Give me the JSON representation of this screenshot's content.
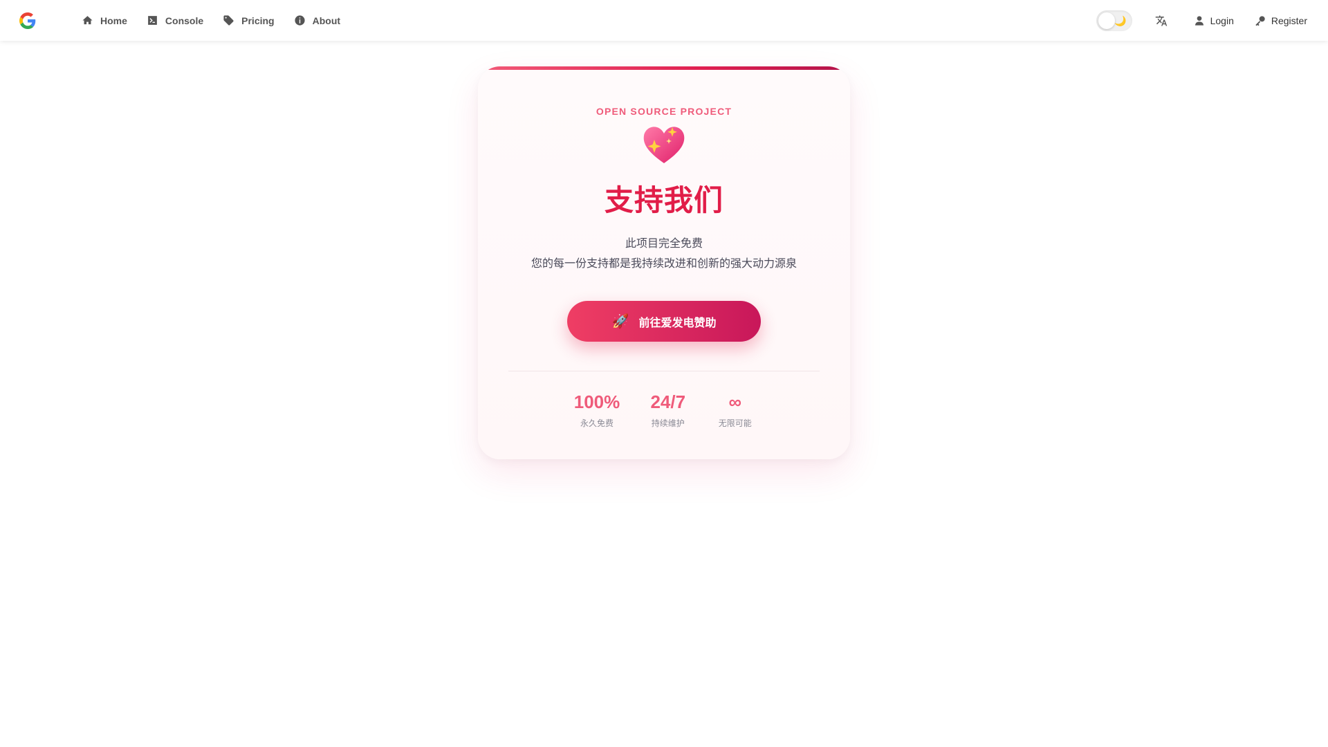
{
  "nav": {
    "items": [
      {
        "label": "Home",
        "icon": "home-icon"
      },
      {
        "label": "Console",
        "icon": "terminal-icon"
      },
      {
        "label": "Pricing",
        "icon": "tag-icon"
      },
      {
        "label": "About",
        "icon": "info-icon"
      }
    ],
    "login_label": "Login",
    "register_label": "Register",
    "theme_toggle_glyph": "🌙"
  },
  "card": {
    "eyebrow": "OPEN SOURCE PROJECT",
    "heart_icon": "sparkling-heart-icon",
    "title": "支持我们",
    "desc_line1": "此项目完全免费",
    "desc_line2": "您的每一份支持都是我持续改进和创新的强大动力源泉",
    "cta_glyph": "🚀",
    "cta_label": "前往爱发电赞助",
    "stats": [
      {
        "value": "100%",
        "label": "永久免费"
      },
      {
        "value": "24/7",
        "label": "持续维护"
      },
      {
        "value": "∞",
        "label": "无限可能"
      }
    ]
  },
  "colors": {
    "accent": "#e11d48",
    "accent_light": "#ef5b7a",
    "nav_text": "#555555"
  }
}
